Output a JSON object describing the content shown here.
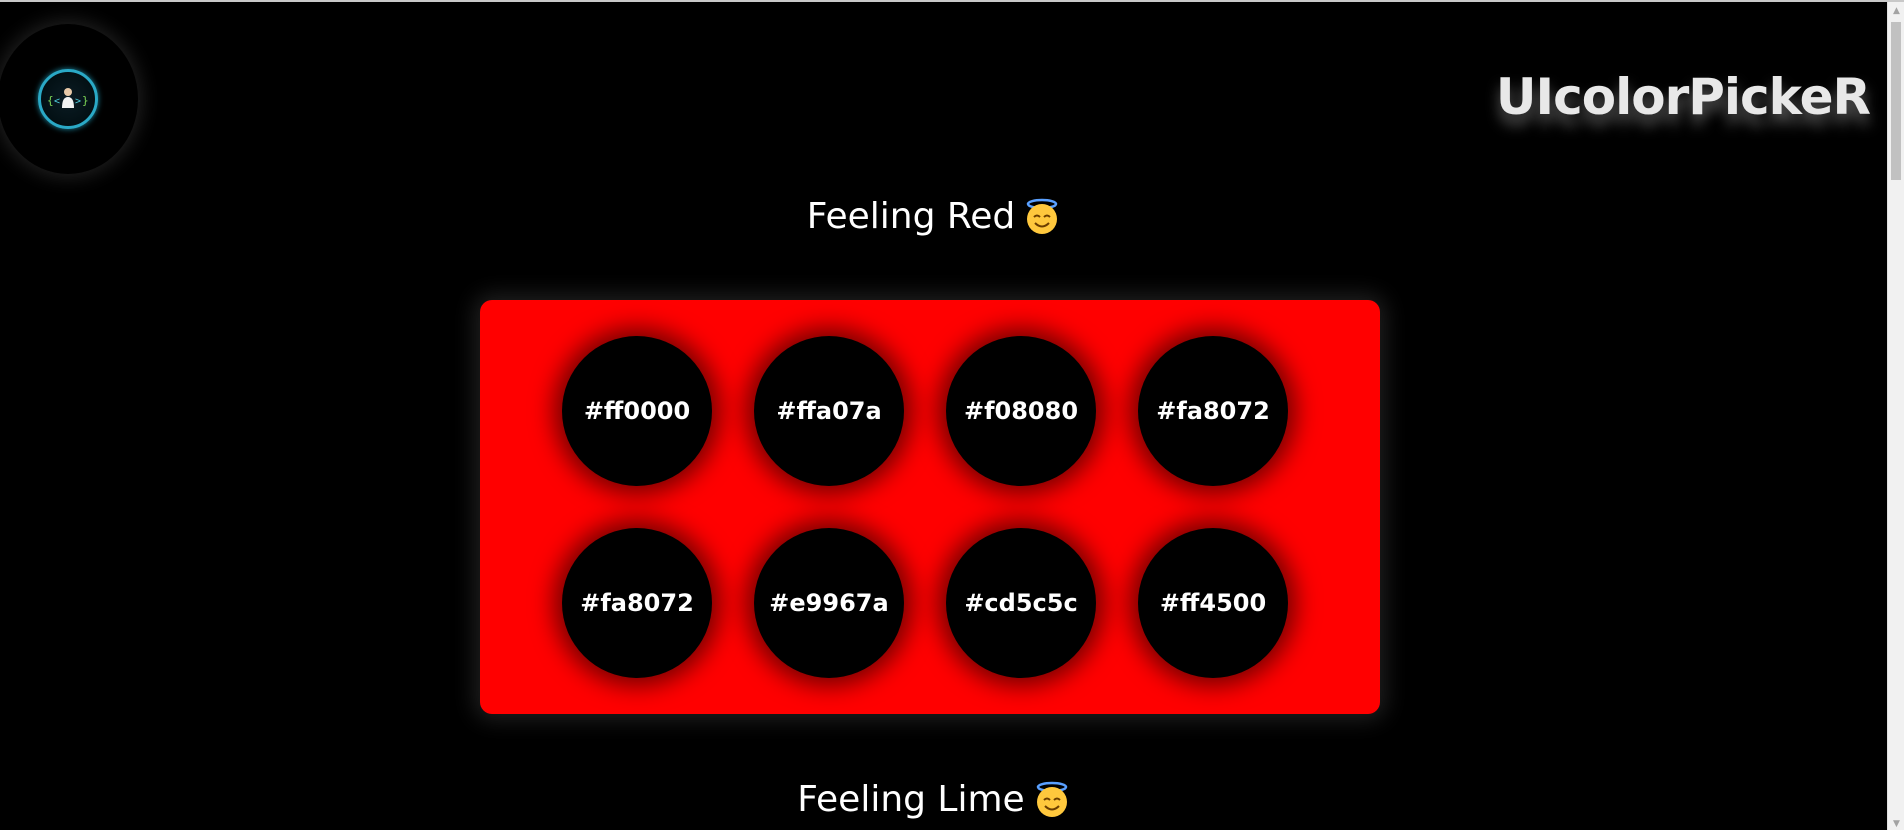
{
  "brand": {
    "title": "UIcolorPickeR"
  },
  "logo": {
    "icon": "coder-avatar-icon",
    "accent": "#2aa9c6"
  },
  "sections": [
    {
      "title": "Feeling Red",
      "emoji": "smiling-face-with-halo-icon",
      "panel_color": "#ff0000",
      "colors": [
        "#ff0000",
        "#ffa07a",
        "#f08080",
        "#fa8072",
        "#fa8072",
        "#e9967a",
        "#cd5c5c",
        "#ff4500"
      ]
    },
    {
      "title": "Feeling Lime",
      "emoji": "smiling-face-with-halo-icon"
    }
  ]
}
